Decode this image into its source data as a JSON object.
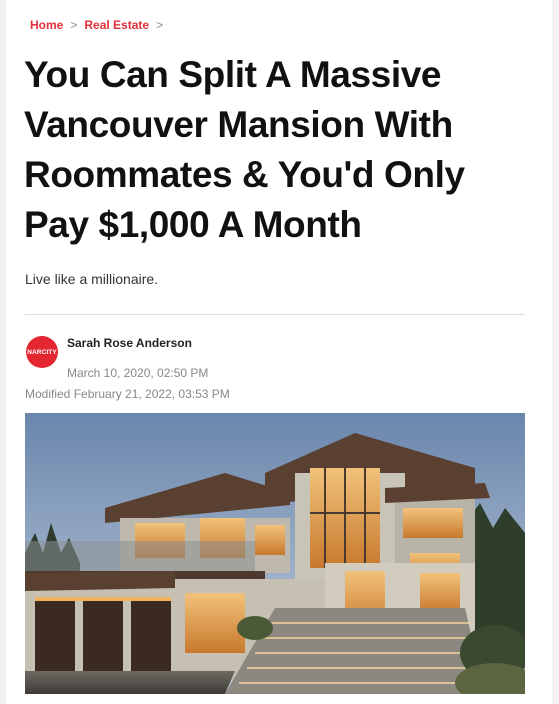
{
  "breadcrumb": {
    "items": [
      "Home",
      "Real Estate"
    ],
    "separator": ">"
  },
  "article": {
    "title": "You Can Split A Massive Vancouver Mansion With Roommates & You'd Only Pay $1,000 A Month",
    "subtitle": "Live like a millionaire.",
    "author": "Sarah Rose Anderson",
    "avatar_text": "NARCITY",
    "published": "March 10, 2020, 02:50 PM",
    "modified": "Modified February 21, 2022, 03:53 PM"
  },
  "colors": {
    "accent": "#e0303b",
    "avatar": "#e3262f"
  }
}
